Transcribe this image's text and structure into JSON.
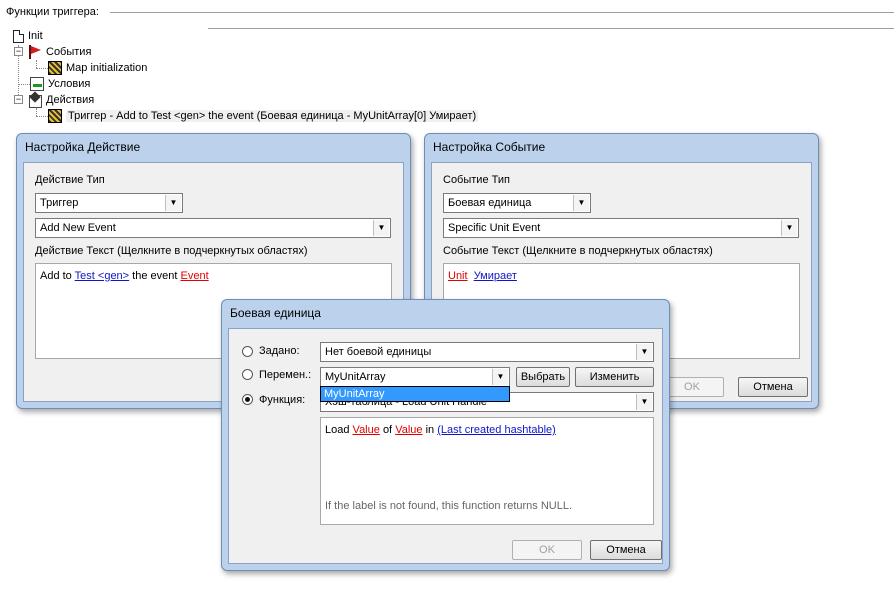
{
  "tree": {
    "header": "Функции триггера:",
    "init": "Init",
    "events": "События",
    "event_item": "Map initialization",
    "conditions": "Условия",
    "actions": "Действия",
    "action_item": "Триггер - Add to Test <gen> the event (Боевая единица - MyUnitArray[0] Умирает)"
  },
  "action_dialog": {
    "title": "Настройка Действие",
    "type_label": "Действие Тип",
    "type_value": "Триггер",
    "action_value": "Add New Event",
    "text_label": "Действие Текст (Щелкните в подчеркнутых областях)",
    "text": {
      "prefix": "Add to",
      "link1": "Test <gen>",
      "mid": "the event",
      "link2": "Event"
    }
  },
  "event_dialog": {
    "title": "Настройка Событие",
    "type_label": "Событие Тип",
    "type_value": "Боевая единица",
    "event_value": "Specific Unit Event",
    "text_label": "Событие Текст (Щелкните в подчеркнутых областях)",
    "text": {
      "link1": "Unit",
      "link2": "Умирает"
    },
    "ok": "OK",
    "cancel": "Отмена"
  },
  "unit_dialog": {
    "title": "Боевая единица",
    "preset_label": "Задано:",
    "preset_value": "Нет боевой единицы",
    "variable_label": "Перемен.:",
    "variable_value": "MyUnitArray",
    "select_button": "Выбрать",
    "edit_button": "Изменить",
    "function_label": "Функция:",
    "function_value": "Хэш-таблица - Load Unit Handle",
    "dropdown_item": "MyUnitArray",
    "text": {
      "load": "Load",
      "value1": "Value",
      "of": "of",
      "value2": "Value",
      "in": "in",
      "hashtable": "(Last created hashtable)"
    },
    "hint": "If the label is not found, this function returns NULL.",
    "ok": "OK",
    "cancel": "Отмена",
    "selected_option": "function"
  }
}
